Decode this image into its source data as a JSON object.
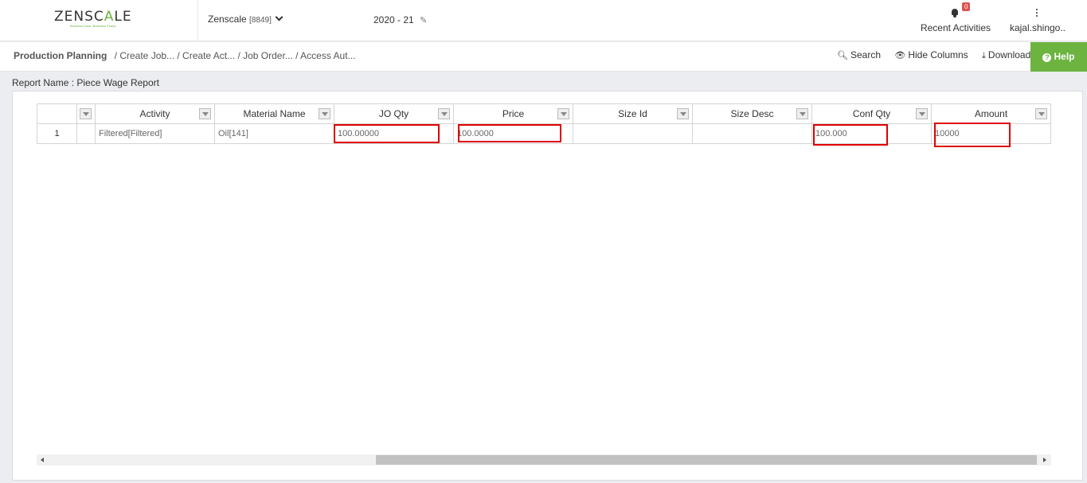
{
  "header": {
    "logo_text_a": "ZENSC",
    "logo_text_b": "A",
    "logo_text_c": "LE",
    "logo_tagline": "Business Ease. Business Peace.",
    "company_name": "Zenscale",
    "company_code": "[8849]",
    "fiscal_year": "2020 - 21",
    "recent_activities_label": "Recent Activities",
    "notification_count": "0",
    "user_name": "kajal.shingo.."
  },
  "breadcrumb": {
    "root": "Production Planning",
    "items": [
      "/ Create Job...",
      "/ Create Act...",
      "/ Job Order...",
      "/ Access Aut..."
    ]
  },
  "toolbar": {
    "search_label": "Search",
    "hide_columns_label": "Hide Columns",
    "download_label": "Download",
    "help_label": "Help"
  },
  "report": {
    "name_label": "Report Name : Piece Wage Report"
  },
  "table": {
    "columns": [
      "",
      "Activity",
      "Material Name",
      "JO Qty",
      "Price",
      "Size Id",
      "Size Desc",
      "Conf Qty",
      "Amount"
    ],
    "rows": [
      {
        "index": "1",
        "blank": "",
        "activity": "Filtered[Filtered]",
        "material": "Oil[141]",
        "jo_qty": "100.00000",
        "price": "100.0000",
        "size_id": "",
        "size_desc": "",
        "conf_qty": "100.000",
        "amount": "10000"
      }
    ]
  },
  "colors": {
    "brand_green": "#6cb33f",
    "highlight_red": "#e00000",
    "badge_red": "#d9534f"
  }
}
